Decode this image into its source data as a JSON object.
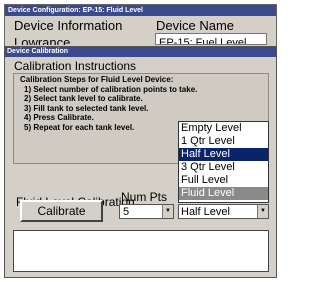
{
  "outer_window": {
    "title": "Device Configuration: EP-15: Fluid Level",
    "device_information_label": "Device Information",
    "device_name_label": "Device Name",
    "manufacturer_value": "Lowrance",
    "device_name_value": "EP-15: Fuel Level"
  },
  "calibration_dialog": {
    "title": "Device Calibration",
    "instructions_heading": "Calibration Instructions",
    "instructions": [
      "Calibration Steps for Fluid Level Device:",
      "1) Select number of calibration points to take.",
      "2) Select tank level to calibrate.",
      "3) Fill tank to selected tank level.",
      "4) Press Calibrate.",
      "5) Repeat for each tank level."
    ],
    "fluid_level_calibration_label": "Fluid Level Calibration",
    "num_pts_label": "Num Pts",
    "num_pts_value": "5",
    "calibrate_button": "Calibrate",
    "tank_level_value": "Half Level",
    "tank_level_options": [
      "Empty Level",
      "1 Qtr Level",
      "Half Level",
      "3 Qtr Level",
      "Full Level",
      "Fluid Level"
    ],
    "selected_option_index": 2,
    "hovered_option_index": 5
  },
  "colors": {
    "title_bar": "#3a4a8c",
    "dialog_face": "#d4d0c8",
    "selection": "#0a246a",
    "hover": "#8a8a8a"
  }
}
